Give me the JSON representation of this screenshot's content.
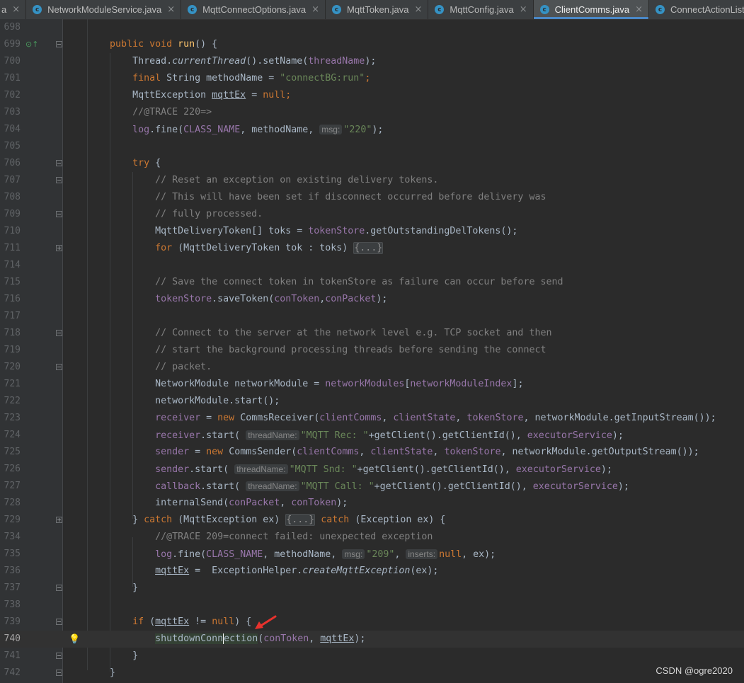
{
  "tabs": [
    {
      "label": "a",
      "icon": "class-icon",
      "active": false
    },
    {
      "label": "NetworkModuleService.java",
      "icon": "class-icon",
      "active": false
    },
    {
      "label": "MqttConnectOptions.java",
      "icon": "class-icon",
      "active": false
    },
    {
      "label": "MqttToken.java",
      "icon": "class-icon",
      "active": false
    },
    {
      "label": "MqttConfig.java",
      "icon": "class-icon",
      "active": false
    },
    {
      "label": "ClientComms.java",
      "icon": "class-icon",
      "active": true
    },
    {
      "label": "ConnectActionListener.java",
      "icon": "class-icon",
      "active": false
    }
  ],
  "tab_close_glyph": "×",
  "tab_icon_letter": "c",
  "editor": {
    "lines": [
      {
        "num": "698",
        "fold": "",
        "code": []
      },
      {
        "num": "699",
        "fold": "minus",
        "marker": "override-up-icon",
        "code": [
          [
            "        ",
            ""
          ],
          [
            "public void ",
            "k"
          ],
          [
            "run",
            "m"
          ],
          [
            "() {",
            ""
          ]
        ]
      },
      {
        "num": "700",
        "fold": "",
        "code": [
          [
            "            Thread.",
            ""
          ],
          [
            "currentThread",
            "i"
          ],
          [
            "().setName(",
            ""
          ],
          [
            "threadName",
            "f"
          ],
          [
            ");",
            ""
          ]
        ]
      },
      {
        "num": "701",
        "fold": "",
        "code": [
          [
            "            ",
            ""
          ],
          [
            "final ",
            "k"
          ],
          [
            "String methodName = ",
            ""
          ],
          [
            "\"connectBG:run\"",
            "s"
          ],
          [
            ";",
            "k"
          ]
        ]
      },
      {
        "num": "702",
        "fold": "",
        "code": [
          [
            "            MqttException ",
            ""
          ],
          [
            "mqttEx",
            "u"
          ],
          [
            " = ",
            ""
          ],
          [
            "null",
            "k"
          ],
          [
            ";",
            "k"
          ]
        ]
      },
      {
        "num": "703",
        "fold": "",
        "code": [
          [
            "            //@TRACE 220=>",
            "c"
          ]
        ]
      },
      {
        "num": "704",
        "fold": "",
        "code": [
          [
            "            ",
            ""
          ],
          [
            "log",
            "f"
          ],
          [
            ".fine(",
            ""
          ],
          [
            "CLASS_NAME",
            "f"
          ],
          [
            ", methodName, ",
            ""
          ],
          [
            "msg:",
            "hint"
          ],
          [
            "\"220\"",
            "s"
          ],
          [
            ");",
            ""
          ]
        ]
      },
      {
        "num": "705",
        "fold": "",
        "code": []
      },
      {
        "num": "706",
        "fold": "minus",
        "code": [
          [
            "            ",
            ""
          ],
          [
            "try ",
            "k"
          ],
          [
            "{",
            ""
          ]
        ]
      },
      {
        "num": "707",
        "fold": "minus",
        "code": [
          [
            "                // Reset an exception on existing delivery tokens.",
            "c"
          ]
        ]
      },
      {
        "num": "708",
        "fold": "",
        "code": [
          [
            "                // This will have been set if disconnect occurred before delivery was",
            "c"
          ]
        ]
      },
      {
        "num": "709",
        "fold": "minus",
        "code": [
          [
            "                // fully processed.",
            "c"
          ]
        ]
      },
      {
        "num": "710",
        "fold": "",
        "code": [
          [
            "                MqttDeliveryToken[] toks = ",
            ""
          ],
          [
            "tokenStore",
            "f"
          ],
          [
            ".getOutstandingDelTokens();",
            ""
          ]
        ]
      },
      {
        "num": "711",
        "fold": "plus",
        "code": [
          [
            "                ",
            ""
          ],
          [
            "for ",
            "k"
          ],
          [
            "(MqttDeliveryToken tok : toks) ",
            ""
          ],
          [
            "{...}",
            "folded"
          ]
        ]
      },
      {
        "num": "714",
        "fold": "",
        "code": []
      },
      {
        "num": "715",
        "fold": "",
        "code": [
          [
            "                // Save the connect token in tokenStore as failure can occur before send",
            "c"
          ]
        ]
      },
      {
        "num": "716",
        "fold": "",
        "code": [
          [
            "                ",
            ""
          ],
          [
            "tokenStore",
            "f"
          ],
          [
            ".saveToken(",
            ""
          ],
          [
            "conToken",
            "f"
          ],
          [
            ",",
            ""
          ],
          [
            "conPacket",
            "f"
          ],
          [
            ");",
            ""
          ]
        ]
      },
      {
        "num": "717",
        "fold": "",
        "code": []
      },
      {
        "num": "718",
        "fold": "minus",
        "code": [
          [
            "                // Connect to the server at the network level e.g. TCP socket and then",
            "c"
          ]
        ]
      },
      {
        "num": "719",
        "fold": "",
        "code": [
          [
            "                // start the background processing threads before sending the connect",
            "c"
          ]
        ]
      },
      {
        "num": "720",
        "fold": "minus",
        "code": [
          [
            "                // packet.",
            "c"
          ]
        ]
      },
      {
        "num": "721",
        "fold": "",
        "code": [
          [
            "                NetworkModule networkModule = ",
            ""
          ],
          [
            "networkModules",
            "f"
          ],
          [
            "[",
            ""
          ],
          [
            "networkModuleIndex",
            "f"
          ],
          [
            "];",
            ""
          ]
        ]
      },
      {
        "num": "722",
        "fold": "",
        "code": [
          [
            "                networkModule.start();",
            ""
          ]
        ]
      },
      {
        "num": "723",
        "fold": "",
        "code": [
          [
            "                ",
            ""
          ],
          [
            "receiver",
            "f"
          ],
          [
            " = ",
            ""
          ],
          [
            "new ",
            "k"
          ],
          [
            "CommsReceiver(",
            ""
          ],
          [
            "clientComms",
            "f"
          ],
          [
            ", ",
            ""
          ],
          [
            "clientState",
            "f"
          ],
          [
            ", ",
            ""
          ],
          [
            "tokenStore",
            "f"
          ],
          [
            ", networkModule.getInputStream());",
            ""
          ]
        ]
      },
      {
        "num": "724",
        "fold": "",
        "code": [
          [
            "                ",
            ""
          ],
          [
            "receiver",
            "f"
          ],
          [
            ".start( ",
            ""
          ],
          [
            "threadName:",
            "hint"
          ],
          [
            "\"MQTT Rec: \"",
            "s"
          ],
          [
            "+getClient().getClientId(), ",
            ""
          ],
          [
            "executorService",
            "f"
          ],
          [
            ");",
            ""
          ]
        ]
      },
      {
        "num": "725",
        "fold": "",
        "code": [
          [
            "                ",
            ""
          ],
          [
            "sender",
            "f"
          ],
          [
            " = ",
            ""
          ],
          [
            "new ",
            "k"
          ],
          [
            "CommsSender(",
            ""
          ],
          [
            "clientComms",
            "f"
          ],
          [
            ", ",
            ""
          ],
          [
            "clientState",
            "f"
          ],
          [
            ", ",
            ""
          ],
          [
            "tokenStore",
            "f"
          ],
          [
            ", networkModule.getOutputStream());",
            ""
          ]
        ]
      },
      {
        "num": "726",
        "fold": "",
        "code": [
          [
            "                ",
            ""
          ],
          [
            "sender",
            "f"
          ],
          [
            ".start( ",
            ""
          ],
          [
            "threadName:",
            "hint"
          ],
          [
            "\"MQTT Snd: \"",
            "s"
          ],
          [
            "+getClient().getClientId(), ",
            ""
          ],
          [
            "executorService",
            "f"
          ],
          [
            ");",
            ""
          ]
        ]
      },
      {
        "num": "727",
        "fold": "",
        "code": [
          [
            "                ",
            ""
          ],
          [
            "callback",
            "f"
          ],
          [
            ".start( ",
            ""
          ],
          [
            "threadName:",
            "hint"
          ],
          [
            "\"MQTT Call: \"",
            "s"
          ],
          [
            "+getClient().getClientId(), ",
            ""
          ],
          [
            "executorService",
            "f"
          ],
          [
            ");",
            ""
          ]
        ]
      },
      {
        "num": "728",
        "fold": "",
        "code": [
          [
            "                internalSend(",
            ""
          ],
          [
            "conPacket",
            "f"
          ],
          [
            ", ",
            ""
          ],
          [
            "conToken",
            "f"
          ],
          [
            ");",
            ""
          ]
        ]
      },
      {
        "num": "729",
        "fold": "plus",
        "code": [
          [
            "            } ",
            ""
          ],
          [
            "catch ",
            "k"
          ],
          [
            "(MqttException ex) ",
            ""
          ],
          [
            "{...}",
            "folded"
          ],
          [
            " ",
            ""
          ],
          [
            "catch ",
            "k"
          ],
          [
            "(Exception ex) {",
            ""
          ]
        ]
      },
      {
        "num": "734",
        "fold": "",
        "code": [
          [
            "                //@TRACE 209=connect failed: unexpected exception",
            "c"
          ]
        ]
      },
      {
        "num": "735",
        "fold": "",
        "code": [
          [
            "                ",
            ""
          ],
          [
            "log",
            "f"
          ],
          [
            ".fine(",
            ""
          ],
          [
            "CLASS_NAME",
            "f"
          ],
          [
            ", methodName, ",
            ""
          ],
          [
            "msg:",
            "hint"
          ],
          [
            "\"209\"",
            "s"
          ],
          [
            ", ",
            ""
          ],
          [
            "inserts:",
            "hint"
          ],
          [
            "null",
            "k"
          ],
          [
            ", ex);",
            ""
          ]
        ]
      },
      {
        "num": "736",
        "fold": "",
        "code": [
          [
            "                ",
            ""
          ],
          [
            "mqttEx",
            "u"
          ],
          [
            " =  ExceptionHelper.",
            ""
          ],
          [
            "createMqttException",
            "i"
          ],
          [
            "(ex);",
            ""
          ]
        ]
      },
      {
        "num": "737",
        "fold": "minus",
        "code": [
          [
            "            }",
            ""
          ]
        ]
      },
      {
        "num": "738",
        "fold": "",
        "code": []
      },
      {
        "num": "739",
        "fold": "minus",
        "code": [
          [
            "            ",
            ""
          ],
          [
            "if ",
            "k"
          ],
          [
            "(",
            ""
          ],
          [
            "mqttEx",
            "u"
          ],
          [
            " != ",
            ""
          ],
          [
            "null",
            "k"
          ],
          [
            ") {",
            ""
          ]
        ]
      },
      {
        "num": "740",
        "fold": "",
        "current": true,
        "bulb": "lightbulb-icon",
        "code": [
          [
            "                ",
            ""
          ],
          [
            "shutdownConn",
            "idref"
          ],
          [
            "ection",
            "idref caret"
          ],
          [
            "(",
            ""
          ],
          [
            "conToken",
            "f"
          ],
          [
            ", ",
            ""
          ],
          [
            "mqttEx",
            "u"
          ],
          [
            ");",
            ""
          ]
        ]
      },
      {
        "num": "741",
        "fold": "minus",
        "code": [
          [
            "            }",
            ""
          ]
        ]
      },
      {
        "num": "742",
        "fold": "minus",
        "code": [
          [
            "        }",
            ""
          ]
        ]
      }
    ]
  },
  "annotation": {
    "icon": "red-arrow-icon",
    "color": "#e8322d"
  },
  "watermark": "CSDN @ogre2020",
  "colors": {
    "background": "#2b2b2b",
    "keyword": "#cc7832",
    "field": "#9876aa",
    "string": "#6a8759",
    "comment": "#808080",
    "method_decl": "#ffc66d",
    "plain": "#a9b7c6",
    "tab_accent": "#4a88c7"
  }
}
